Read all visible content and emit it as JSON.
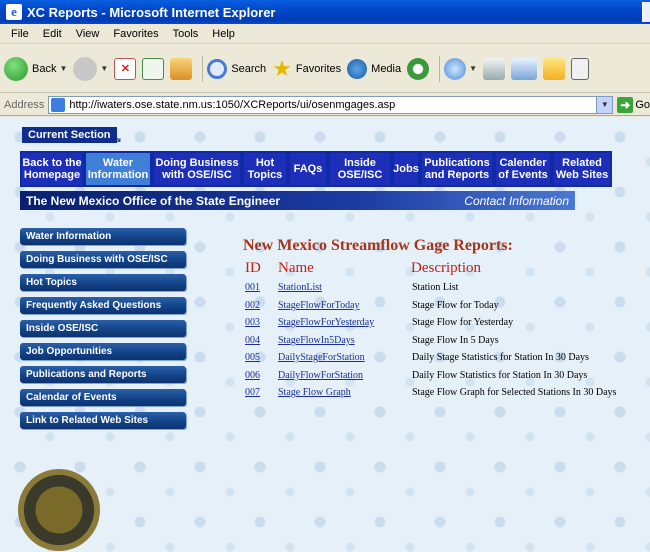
{
  "window": {
    "title": "XC Reports - Microsoft Internet Explorer"
  },
  "menu": [
    "File",
    "Edit",
    "View",
    "Favorites",
    "Tools",
    "Help"
  ],
  "toolbar": {
    "back": "Back",
    "search": "Search",
    "favorites": "Favorites",
    "media": "Media"
  },
  "address": {
    "label": "Address",
    "url": "http://iwaters.ose.state.nm.us:1050/XCReports/ui/osenmgages.asp",
    "go": "Go"
  },
  "site": {
    "current_section": "Current Section",
    "nav": [
      {
        "label": "Back to the Homepage"
      },
      {
        "label": "Water Information"
      },
      {
        "label": "Doing Business with OSE/ISC"
      },
      {
        "label": "Hot Topics"
      },
      {
        "label": "FAQs"
      },
      {
        "label": "Inside OSE/ISC"
      },
      {
        "label": "Jobs"
      },
      {
        "label": "Publications and Reports"
      },
      {
        "label": "Calender of Events"
      },
      {
        "label": "Related Web Sites"
      }
    ],
    "banner_title": "The New Mexico Office of the State Engineer",
    "contact": "Contact Information",
    "sidebar": [
      "Water Information",
      "Doing Business with OSE/ISC",
      "Hot Topics",
      "Frequently Asked Questions",
      "Inside OSE/ISC",
      "Job Opportunities",
      "Publications and Reports",
      "Calendar of Events",
      "Link to Related Web Sites"
    ]
  },
  "reports": {
    "heading": "New Mexico Streamflow Gage Reports:",
    "col_id": "ID",
    "col_name": "Name",
    "col_desc": "Description",
    "rows": [
      {
        "id": "001",
        "name": "StationList",
        "desc": "Station List"
      },
      {
        "id": "002",
        "name": "StageFlowForToday",
        "desc": "Stage Flow for Today"
      },
      {
        "id": "003",
        "name": "StageFlowForYesterday",
        "desc": "Stage Flow for Yesterday"
      },
      {
        "id": "004",
        "name": "StageFlowIn5Days",
        "desc": "Stage Flow In 5 Days"
      },
      {
        "id": "005",
        "name": "DailyStageForStation",
        "desc": "Daily Stage Statistics for Station In 30 Days"
      },
      {
        "id": "006",
        "name": "DailyFlowForStation",
        "desc": "Daily Flow Statistics for Station In 30 Days"
      },
      {
        "id": "007",
        "name": "Stage Flow Graph",
        "desc": "Stage Flow Graph for Selected Stations In 30 Days"
      }
    ]
  }
}
